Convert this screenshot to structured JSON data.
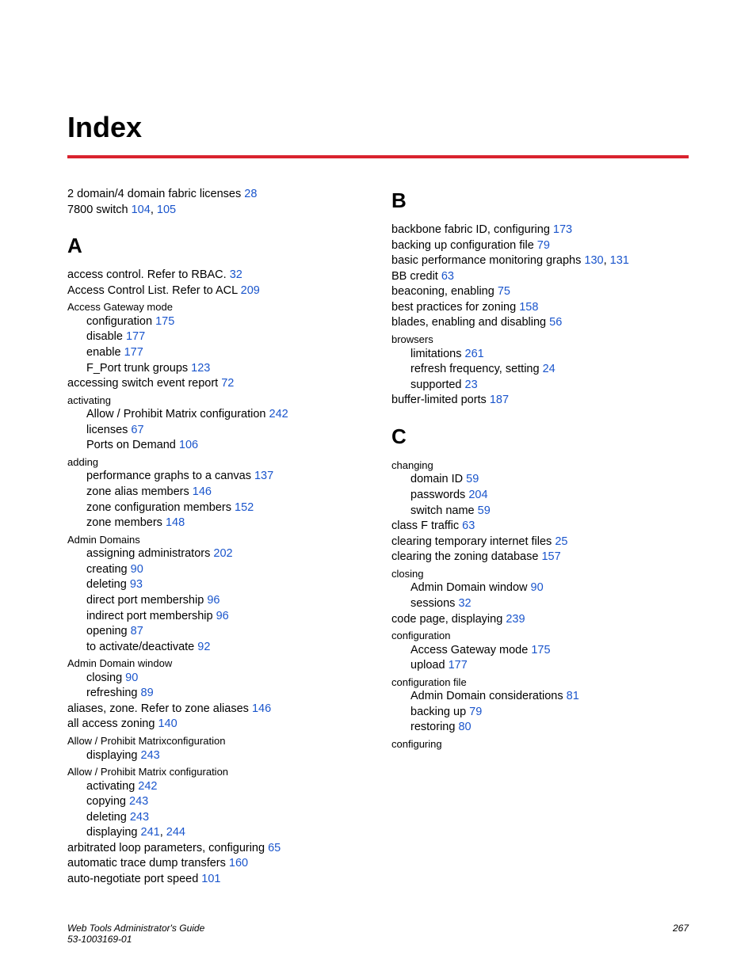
{
  "title": "Index",
  "pre": [
    {
      "text": "2 domain/4 domain fabric licenses ",
      "link": "28"
    },
    {
      "text": "7800 switch ",
      "links": [
        "104",
        "105"
      ]
    }
  ],
  "sections": [
    {
      "letter": "A",
      "entries": [
        {
          "text": "access control. Refer to RBAC. ",
          "links": [
            "32"
          ]
        },
        {
          "text": "Access Control List. Refer to ACL ",
          "links": [
            "209"
          ]
        },
        {
          "label": "Access Gateway mode"
        },
        {
          "sub": true,
          "text": "configuration ",
          "links": [
            "175"
          ]
        },
        {
          "sub": true,
          "text": "disable ",
          "links": [
            "177"
          ]
        },
        {
          "sub": true,
          "text": "enable ",
          "links": [
            "177"
          ]
        },
        {
          "sub": true,
          "text": "F_Port trunk groups ",
          "links": [
            "123"
          ]
        },
        {
          "text": "accessing switch event report ",
          "links": [
            "72"
          ]
        },
        {
          "label": "activating"
        },
        {
          "sub": true,
          "text": "Allow / Prohibit Matrix configuration ",
          "links": [
            "242"
          ]
        },
        {
          "sub": true,
          "text": "licenses ",
          "links": [
            "67"
          ]
        },
        {
          "sub": true,
          "text": "Ports on Demand ",
          "links": [
            "106"
          ]
        },
        {
          "label": "adding"
        },
        {
          "sub": true,
          "text": "performance graphs to a canvas ",
          "links": [
            "137"
          ]
        },
        {
          "sub": true,
          "text": "zone alias members ",
          "links": [
            "146"
          ]
        },
        {
          "sub": true,
          "text": "zone configuration members ",
          "links": [
            "152"
          ]
        },
        {
          "sub": true,
          "text": "zone members ",
          "links": [
            "148"
          ]
        },
        {
          "label": "Admin Domains"
        },
        {
          "sub": true,
          "text": "assigning administrators ",
          "links": [
            "202"
          ]
        },
        {
          "sub": true,
          "text": "creating ",
          "links": [
            "90"
          ]
        },
        {
          "sub": true,
          "text": "deleting ",
          "links": [
            "93"
          ]
        },
        {
          "sub": true,
          "text": "direct port membership ",
          "links": [
            "96"
          ]
        },
        {
          "sub": true,
          "text": "indirect port membership ",
          "links": [
            "96"
          ]
        },
        {
          "sub": true,
          "text": "opening ",
          "links": [
            "87"
          ]
        },
        {
          "sub": true,
          "text": "to activate/deactivate ",
          "links": [
            "92"
          ]
        },
        {
          "label": "Admin Domain window"
        },
        {
          "sub": true,
          "text": "closing ",
          "links": [
            "90"
          ]
        },
        {
          "sub": true,
          "text": "refreshing ",
          "links": [
            "89"
          ]
        },
        {
          "text": "aliases, zone. Refer to zone aliases ",
          "links": [
            "146"
          ]
        },
        {
          "text": "all access zoning ",
          "links": [
            "140"
          ]
        },
        {
          "label": "Allow / Prohibit Matrixconfiguration"
        },
        {
          "sub": true,
          "text": "displaying ",
          "links": [
            "243"
          ]
        },
        {
          "label": "Allow / Prohibit Matrix configuration"
        },
        {
          "sub": true,
          "text": "activating ",
          "links": [
            "242"
          ]
        },
        {
          "sub": true,
          "text": "copying ",
          "links": [
            "243"
          ]
        },
        {
          "sub": true,
          "text": "deleting ",
          "links": [
            "243"
          ]
        },
        {
          "sub": true,
          "text": "displaying ",
          "links": [
            "241",
            "244"
          ]
        },
        {
          "text": "arbitrated loop parameters, configuring ",
          "links": [
            "65"
          ]
        },
        {
          "text": "automatic trace dump transfers ",
          "links": [
            "160"
          ]
        },
        {
          "text": "auto-negotiate port speed ",
          "links": [
            "101"
          ]
        }
      ]
    },
    {
      "letter": "B",
      "entries": [
        {
          "text": "backbone fabric ID, configuring ",
          "links": [
            "173"
          ]
        },
        {
          "text": "backing up configuration file ",
          "links": [
            "79"
          ]
        },
        {
          "text": "basic performance monitoring graphs ",
          "links": [
            "130",
            "131"
          ]
        },
        {
          "text": "BB credit ",
          "links": [
            "63"
          ]
        },
        {
          "text": "beaconing, enabling ",
          "links": [
            "75"
          ]
        },
        {
          "text": "best practices for zoning ",
          "links": [
            "158"
          ]
        },
        {
          "text": "blades, enabling and disabling ",
          "links": [
            "56"
          ]
        },
        {
          "label": "browsers"
        },
        {
          "sub": true,
          "text": "limitations ",
          "links": [
            "261"
          ]
        },
        {
          "sub": true,
          "text": "refresh frequency, setting ",
          "links": [
            "24"
          ]
        },
        {
          "sub": true,
          "text": "supported ",
          "links": [
            "23"
          ]
        },
        {
          "text": "buffer-limited ports ",
          "links": [
            "187"
          ]
        }
      ]
    },
    {
      "letter": "C",
      "entries": [
        {
          "label": "changing"
        },
        {
          "sub": true,
          "text": "domain ID ",
          "links": [
            "59"
          ]
        },
        {
          "sub": true,
          "text": "passwords ",
          "links": [
            "204"
          ]
        },
        {
          "sub": true,
          "text": "switch name ",
          "links": [
            "59"
          ]
        },
        {
          "text": "class F traffic ",
          "links": [
            "63"
          ]
        },
        {
          "text": "clearing temporary internet files ",
          "links": [
            "25"
          ]
        },
        {
          "text": "clearing the zoning database ",
          "links": [
            "157"
          ]
        },
        {
          "label": "closing"
        },
        {
          "sub": true,
          "text": "Admin Domain window ",
          "links": [
            "90"
          ]
        },
        {
          "sub": true,
          "text": "sessions ",
          "links": [
            "32"
          ]
        },
        {
          "text": "code page, displaying ",
          "links": [
            "239"
          ]
        },
        {
          "label": "configuration"
        },
        {
          "sub": true,
          "text": "Access Gateway mode ",
          "links": [
            "175"
          ]
        },
        {
          "sub": true,
          "text": "upload ",
          "links": [
            "177"
          ]
        },
        {
          "label": "configuration file"
        },
        {
          "sub": true,
          "text": "Admin Domain considerations ",
          "links": [
            "81"
          ]
        },
        {
          "sub": true,
          "text": "backing up ",
          "links": [
            "79"
          ]
        },
        {
          "sub": true,
          "text": "restoring ",
          "links": [
            "80"
          ]
        },
        {
          "label": "configuring"
        }
      ]
    }
  ],
  "footer": {
    "left1": "Web Tools Administrator's Guide",
    "left2": "53-1003169-01",
    "right": "267"
  }
}
